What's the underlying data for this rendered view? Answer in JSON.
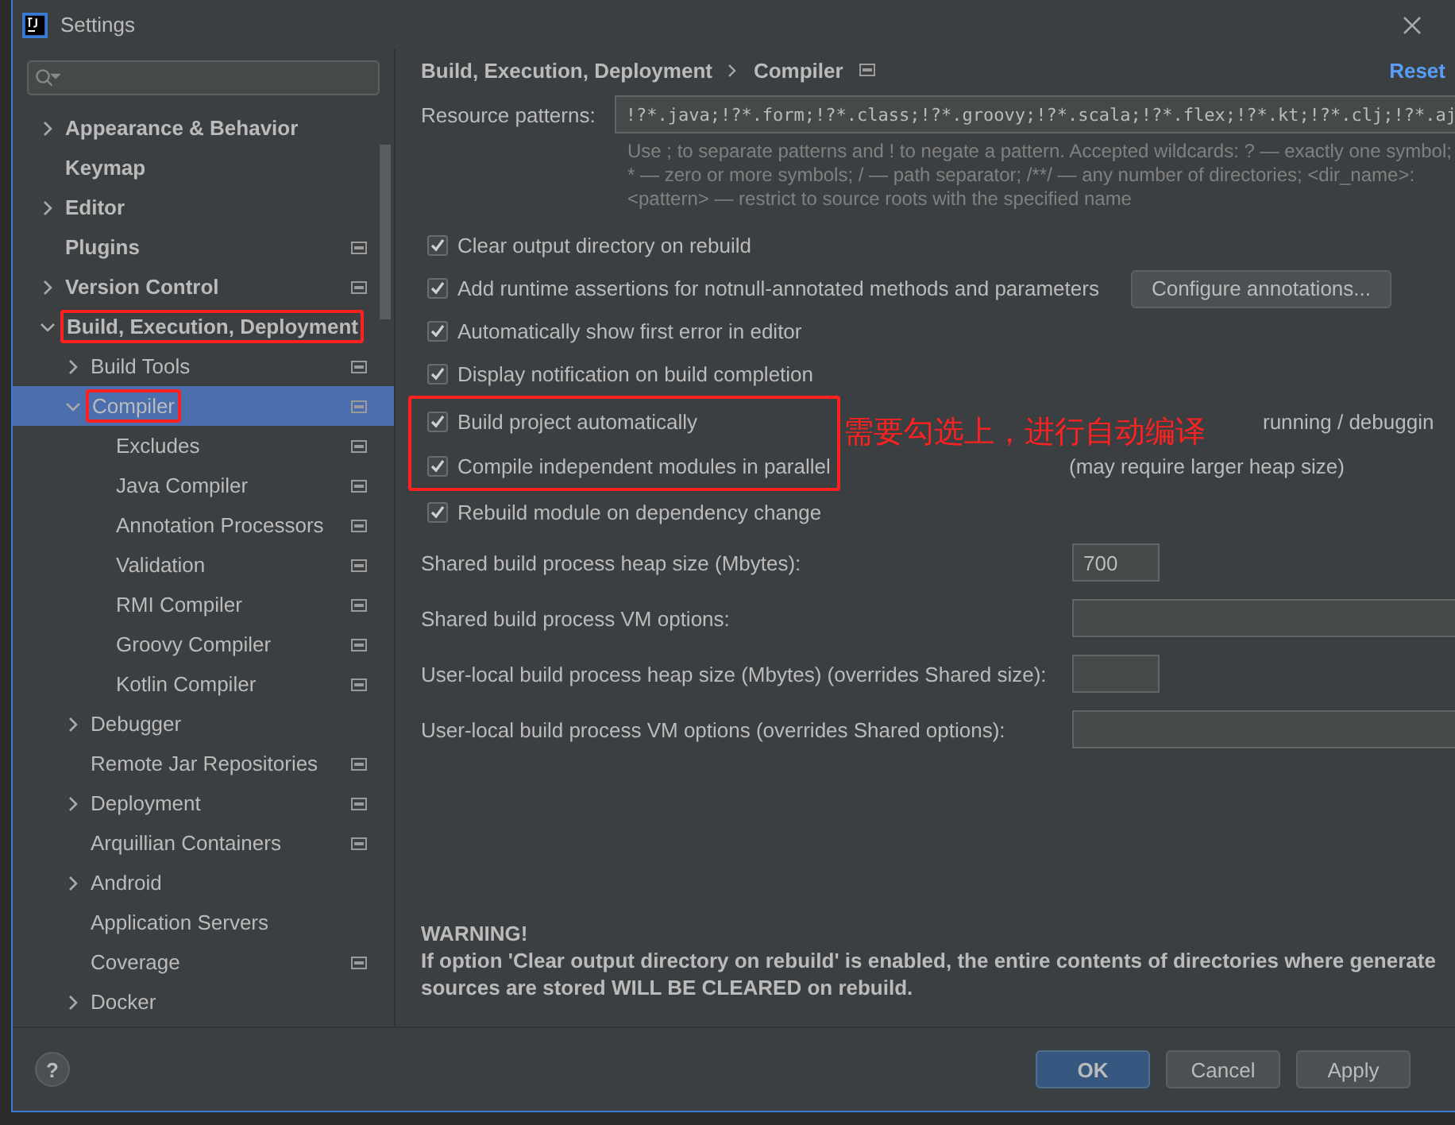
{
  "window": {
    "title": "Settings"
  },
  "sidebar": {
    "items": [
      {
        "label": "Appearance & Behavior",
        "expandable": true,
        "expanded": false,
        "project_icon": false,
        "selected": false,
        "highlighted": false
      },
      {
        "label": "Keymap",
        "expandable": false,
        "project_icon": false,
        "selected": false,
        "highlighted": false
      },
      {
        "label": "Editor",
        "expandable": true,
        "expanded": false,
        "project_icon": false,
        "selected": false,
        "highlighted": false
      },
      {
        "label": "Plugins",
        "expandable": false,
        "project_icon": true,
        "selected": false,
        "highlighted": false
      },
      {
        "label": "Version Control",
        "expandable": true,
        "expanded": false,
        "project_icon": true,
        "selected": false,
        "highlighted": false
      },
      {
        "label": "Build, Execution, Deployment",
        "expandable": true,
        "expanded": true,
        "project_icon": false,
        "selected": false,
        "highlighted": true,
        "children": [
          {
            "label": "Build Tools",
            "expandable": true,
            "expanded": false,
            "project_icon": true,
            "selected": false,
            "highlighted": false
          },
          {
            "label": "Compiler",
            "expandable": true,
            "expanded": true,
            "project_icon": true,
            "selected": true,
            "highlighted": true,
            "children": [
              {
                "label": "Excludes",
                "expandable": false,
                "project_icon": true,
                "selected": false,
                "highlighted": false
              },
              {
                "label": "Java Compiler",
                "expandable": false,
                "project_icon": true,
                "selected": false,
                "highlighted": false
              },
              {
                "label": "Annotation Processors",
                "expandable": false,
                "project_icon": true,
                "selected": false,
                "highlighted": false
              },
              {
                "label": "Validation",
                "expandable": false,
                "project_icon": true,
                "selected": false,
                "highlighted": false
              },
              {
                "label": "RMI Compiler",
                "expandable": false,
                "project_icon": true,
                "selected": false,
                "highlighted": false
              },
              {
                "label": "Groovy Compiler",
                "expandable": false,
                "project_icon": true,
                "selected": false,
                "highlighted": false
              },
              {
                "label": "Kotlin Compiler",
                "expandable": false,
                "project_icon": true,
                "selected": false,
                "highlighted": false
              }
            ]
          },
          {
            "label": "Debugger",
            "expandable": true,
            "expanded": false,
            "project_icon": false,
            "selected": false,
            "highlighted": false
          },
          {
            "label": "Remote Jar Repositories",
            "expandable": false,
            "project_icon": true,
            "selected": false,
            "highlighted": false
          },
          {
            "label": "Deployment",
            "expandable": true,
            "expanded": false,
            "project_icon": true,
            "selected": false,
            "highlighted": false
          },
          {
            "label": "Arquillian Containers",
            "expandable": false,
            "project_icon": true,
            "selected": false,
            "highlighted": false
          },
          {
            "label": "Android",
            "expandable": true,
            "expanded": false,
            "project_icon": false,
            "selected": false,
            "highlighted": false
          },
          {
            "label": "Application Servers",
            "expandable": false,
            "project_icon": false,
            "selected": false,
            "highlighted": false
          },
          {
            "label": "Coverage",
            "expandable": false,
            "project_icon": true,
            "selected": false,
            "highlighted": false
          },
          {
            "label": "Docker",
            "expandable": true,
            "expanded": false,
            "project_icon": false,
            "selected": false,
            "highlighted": false
          }
        ]
      }
    ]
  },
  "breadcrumb": [
    "Build, Execution, Deployment",
    "Compiler"
  ],
  "reset_link": "Reset",
  "resource_patterns": {
    "label": "Resource patterns:",
    "value": "!?*.java;!?*.form;!?*.class;!?*.groovy;!?*.scala;!?*.flex;!?*.kt;!?*.clj;!?*.aj",
    "hint": "Use ; to separate patterns and ! to negate a pattern. Accepted wildcards: ? — exactly one symbol; * — zero or more symbols; / — path separator; /**/ — any number of directories; <dir_name>: <pattern> — restrict to source roots with the specified name"
  },
  "options": [
    {
      "label": "Clear output directory on rebuild",
      "checked": true,
      "highlighted": false
    },
    {
      "label": "Add runtime assertions for notnull-annotated methods and parameters",
      "checked": true,
      "highlighted": false,
      "button": "Configure annotations..."
    },
    {
      "label": "Automatically show first error in editor",
      "checked": true,
      "highlighted": false
    },
    {
      "label": "Display notification on build completion",
      "checked": true,
      "highlighted": false
    },
    {
      "label": "Build project automatically",
      "checked": true,
      "highlighted": true,
      "note": "running / debuggin"
    },
    {
      "label": "Compile independent modules in parallel",
      "checked": true,
      "highlighted": true,
      "note": "(may require larger heap size)"
    },
    {
      "label": "Rebuild module on dependency change",
      "checked": true,
      "highlighted": false
    }
  ],
  "annotation": "需要勾选上，进行自动编译",
  "fields": [
    {
      "label": "Shared build process heap size (Mbytes):",
      "value": "700",
      "kind": "short"
    },
    {
      "label": "Shared build process VM options:",
      "kind": "long"
    },
    {
      "label": "User-local build process heap size (Mbytes) (overrides Shared size):",
      "kind": "short"
    },
    {
      "label": "User-local build process VM options (overrides Shared options):",
      "kind": "long"
    }
  ],
  "warning": {
    "title": "WARNING!",
    "lines": [
      "If option 'Clear output directory on rebuild' is enabled, the entire contents of directories where generate",
      "sources are stored WILL BE CLEARED on rebuild."
    ]
  },
  "footer": {
    "help": "?",
    "buttons": [
      {
        "label": "OK",
        "kind": "primary"
      },
      {
        "label": "Cancel",
        "kind": "normal"
      },
      {
        "label": "Apply",
        "kind": "normal"
      }
    ]
  }
}
